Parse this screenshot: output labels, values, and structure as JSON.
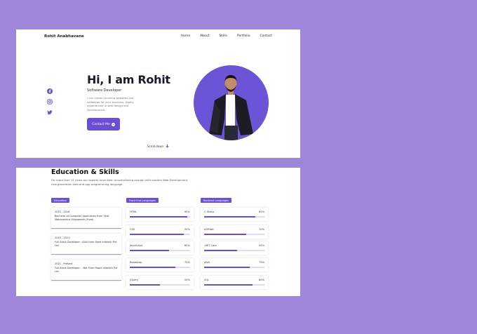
{
  "colors": {
    "background": "#9e86db",
    "accent": "#6a4fd3",
    "photo_bg": "#6b55d6"
  },
  "hero": {
    "brand": "Rohit Anabhavane",
    "nav": [
      "Home",
      "About",
      "Skills",
      "Portfolio",
      "Contact"
    ],
    "social_icons": [
      "facebook-icon",
      "instagram-icon",
      "twitter-icon"
    ],
    "greeting": "Hi, I am Rohit",
    "role": "Software Developer",
    "description": "I can create stunning websites and softwares for your business. Highly experienced in web design and Development.",
    "contact_button": "Contact Me",
    "scroll_text": "Scroll down"
  },
  "education": {
    "title": "Education & Skills",
    "description": "For more than 11 years our experts have been accomplishing enough with modern Web Development, new generation web and app programming language.",
    "columns": {
      "education": "Education",
      "frontend": "Front-End Languages",
      "backend": "Backend Languages"
    },
    "items": [
      {
        "years": "2015 - 2018",
        "degree": "Bachelor of Computer Application from Tilak Maharashtra Vidyapeeth (Pune)"
      },
      {
        "years": "2019 - 2021",
        "degree": "Full Stack Developer - JAVA from Seed Infotech Pvt Ltd"
      },
      {
        "years": "2021 - Present",
        "degree": "Full Stack Developer - .Net From Rapid Infotech Pvt Ltd"
      }
    ],
    "frontend": [
      {
        "name": "HTML",
        "percent": "95%",
        "level": 95
      },
      {
        "name": "CSS",
        "percent": "90%",
        "level": 90
      },
      {
        "name": "JavaScript",
        "percent": "65%",
        "level": 65
      },
      {
        "name": "Bootstrap",
        "percent": "75%",
        "level": 75
      },
      {
        "name": "jQuery",
        "percent": "50%",
        "level": 50
      }
    ],
    "backend": [
      {
        "name": "C Sharp",
        "percent": "85%",
        "level": 85
      },
      {
        "name": "ASP.Net",
        "percent": "70%",
        "level": 70
      },
      {
        "name": ".NET Core",
        "percent": "55%",
        "level": 55
      },
      {
        "name": "JAVA",
        "percent": "75%",
        "level": 75
      },
      {
        "name": "SQL",
        "percent": "80%",
        "level": 80
      }
    ]
  }
}
